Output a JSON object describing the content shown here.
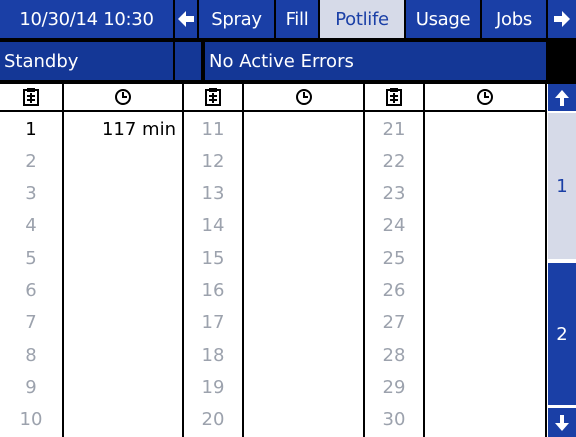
{
  "header": {
    "datetime": "10/30/14 10:30",
    "tabs": [
      {
        "label": "Spray",
        "selected": false
      },
      {
        "label": "Fill",
        "selected": false
      },
      {
        "label": "Potlife",
        "selected": true
      },
      {
        "label": "Usage",
        "selected": false
      },
      {
        "label": "Jobs",
        "selected": false
      }
    ],
    "back_icon": "arrow-left-icon",
    "forward_icon": "arrow-right-icon"
  },
  "status": {
    "mode": "Standby",
    "indicator": "",
    "errors": "No Active Errors"
  },
  "table": {
    "column_icons": [
      "recipe-icon",
      "clock-icon"
    ],
    "rows_col1": [
      "1",
      "2",
      "3",
      "4",
      "5",
      "6",
      "7",
      "8",
      "9",
      "10"
    ],
    "rows_col2": [
      "11",
      "12",
      "13",
      "14",
      "15",
      "16",
      "17",
      "18",
      "19",
      "20"
    ],
    "rows_col3": [
      "21",
      "22",
      "23",
      "24",
      "25",
      "26",
      "27",
      "28",
      "29",
      "30"
    ],
    "values_col1": [
      "117 min",
      "",
      "",
      "",
      "",
      "",
      "",
      "",
      "",
      ""
    ],
    "values_col2": [
      "",
      "",
      "",
      "",
      "",
      "",
      "",
      "",
      "",
      ""
    ],
    "values_col3": [
      "",
      "",
      "",
      "",
      "",
      "",
      "",
      "",
      "",
      ""
    ],
    "active_recipe": "1"
  },
  "pager": {
    "pages": [
      "1",
      "2"
    ],
    "current": "1",
    "up_icon": "arrow-up-icon",
    "down_icon": "arrow-down-icon"
  },
  "colors": {
    "accent": "#1a3fa6",
    "selected_tab": "#d6dae8",
    "inactive_text": "#9ca2ad"
  }
}
